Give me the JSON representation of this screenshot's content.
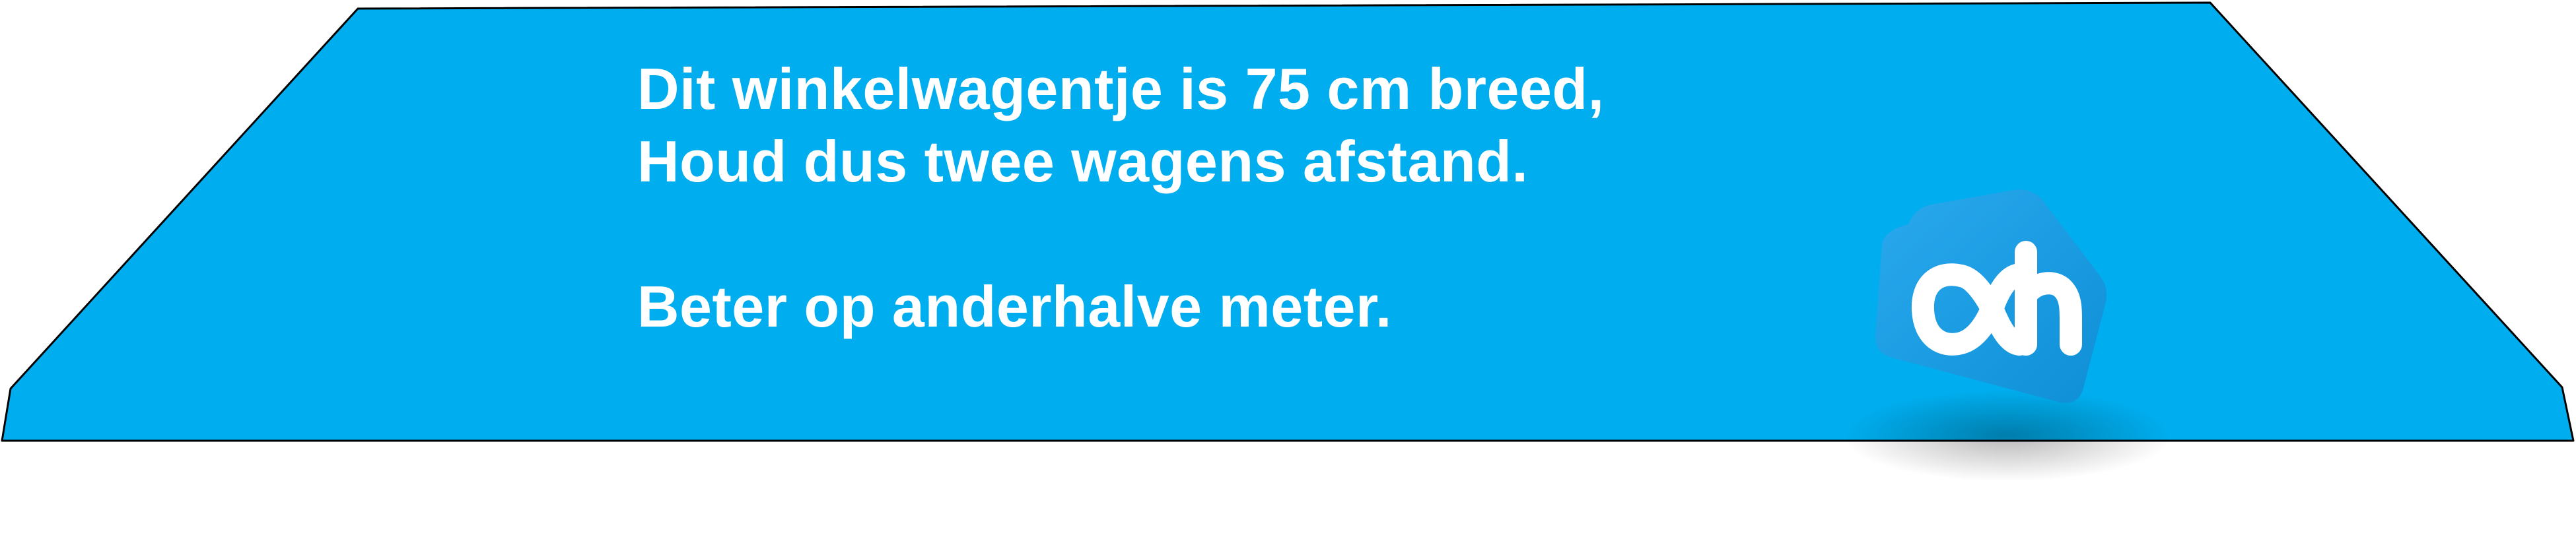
{
  "message": {
    "line1": "Dit winkelwagentje is 75 cm breed,",
    "line2": "Houd dus twee wagens afstand.",
    "tagline": "Beter op anderhalve meter."
  },
  "logo": {
    "icon": "albert-heijn-logo-icon",
    "text": "ah"
  },
  "colors": {
    "banner_blue": "#00aeef",
    "logo_blue": "#1a9fe6",
    "text": "#ffffff",
    "outline": "#000000"
  }
}
